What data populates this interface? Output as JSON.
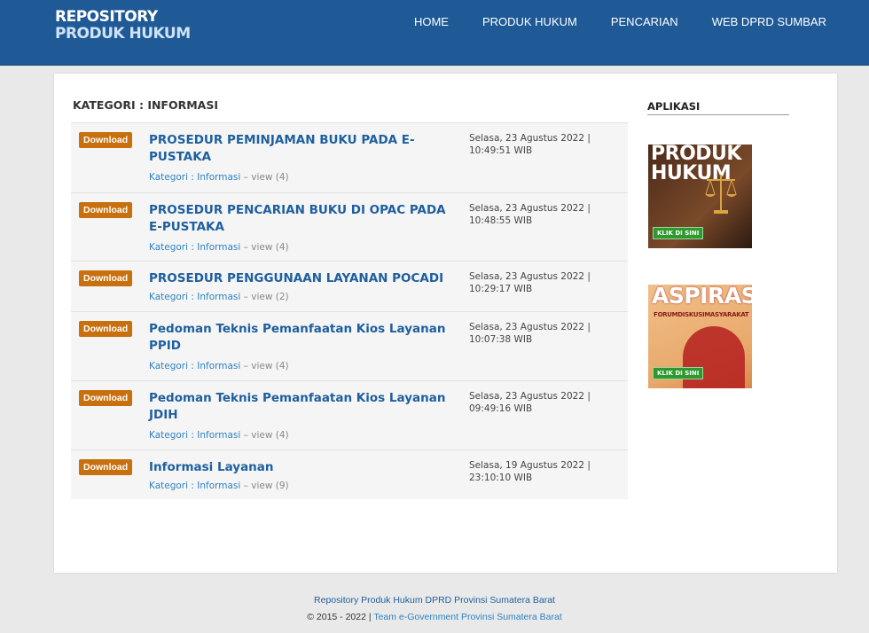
{
  "header": {
    "logo_line1": "REPOSITORY",
    "logo_line2": "PRODUK HUKUM",
    "nav": [
      "HOME",
      "PRODUK HUKUM",
      "PENCARIAN",
      "WEB DPRD SUMBAR"
    ]
  },
  "main": {
    "heading": "KATEGORI : INFORMASI",
    "download_label": "Download",
    "items": [
      {
        "title": "PROSEDUR PEMINJAMAN BUKU PADA E-PUSTAKA",
        "category": "Kategori : Informasi",
        "views": "view (4)",
        "date": "Selasa, 23 Agustus 2022 |",
        "time": "10:49:51 WIB"
      },
      {
        "title": "PROSEDUR PENCARIAN BUKU DI OPAC PADA E-PUSTAKA",
        "category": "Kategori : Informasi",
        "views": "view (4)",
        "date": "Selasa, 23 Agustus 2022 |",
        "time": "10:48:55 WIB"
      },
      {
        "title": "PROSEDUR PENGGUNAAN LAYANAN POCADI",
        "category": "Kategori : Informasi",
        "views": "view (2)",
        "date": "Selasa, 23 Agustus 2022 |",
        "time": "10:29:17 WIB"
      },
      {
        "title": "Pedoman Teknis Pemanfaatan Kios Layanan PPID",
        "category": "Kategori : Informasi",
        "views": "view (4)",
        "date": "Selasa, 23 Agustus 2022 |",
        "time": "10:07:38 WIB"
      },
      {
        "title": "Pedoman Teknis Pemanfaatan Kios Layanan JDIH",
        "category": "Kategori : Informasi",
        "views": "view (4)",
        "date": "Selasa, 23 Agustus 2022 |",
        "time": "09:49:16 WIB"
      },
      {
        "title": "Informasi Layanan",
        "category": "Kategori : Informasi",
        "views": "view (9)",
        "date": "Selasa, 19 Agustus 2022 |",
        "time": "23:10:10 WIB"
      }
    ]
  },
  "sidebar": {
    "title": "APLIKASI",
    "banner1": {
      "big1": "PRODUK",
      "big2": "HUKUM",
      "button": "KLIK DI SINI"
    },
    "banner2": {
      "big": "ASPIRASI",
      "small": "FORUMDISKUSIMASYARAKAT",
      "button": "KLIK DI SINI"
    }
  },
  "footer": {
    "line1": "Repository Produk Hukum DPRD Provinsi Sumatera Barat",
    "line2_prefix": "© 2015 - 2022 | ",
    "line2_link": "Team e-Government Provinsi Sumatera Barat"
  },
  "colors": {
    "header_bg": "#1f5a96",
    "download_bg": "#c9700e",
    "title_link": "#1e5f9e"
  }
}
